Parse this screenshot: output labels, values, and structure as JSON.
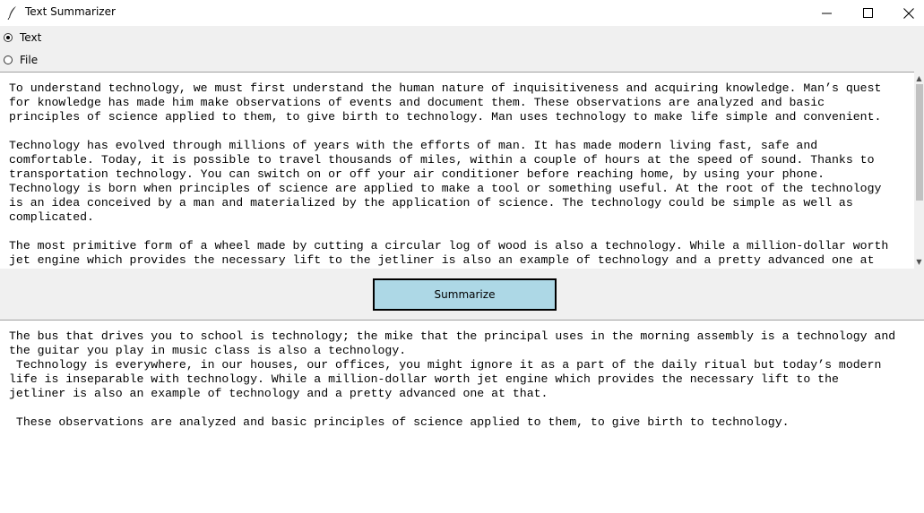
{
  "window": {
    "title": "Text Summarizer"
  },
  "input_mode": {
    "options": [
      {
        "label": "Text",
        "selected": true
      },
      {
        "label": "File",
        "selected": false
      }
    ]
  },
  "input_text": "To understand technology, we must first understand the human nature of inquisitiveness and acquiring knowledge. Man’s quest\nfor knowledge has made him make observations of events and document them. These observations are analyzed and basic\nprinciples of science applied to them, to give birth to technology. Man uses technology to make life simple and convenient.\n\nTechnology has evolved through millions of years with the efforts of man. It has made modern living fast, safe and\ncomfortable. Today, it is possible to travel thousands of miles, within a couple of hours at the speed of sound. Thanks to\ntransportation technology. You can switch on or off your air conditioner before reaching home, by using your phone.\nTechnology is born when principles of science are applied to make a tool or something useful. At the root of the technology\nis an idea conceived by a man and materialized by the application of science. The technology could be simple as well as\ncomplicated.\n\nThe most primitive form of a wheel made by cutting a circular log of wood is also a technology. While a million-dollar worth\njet engine which provides the necessary lift to the jetliner is also an example of technology and a pretty advanced one at",
  "summarize_button": {
    "label": "Summarize"
  },
  "output_text": "The bus that drives you to school is technology; the mike that the principal uses in the morning assembly is a technology and\nthe guitar you play in music class is also a technology.\n Technology is everywhere, in our houses, our offices, you might ignore it as a part of the daily ritual but today’s modern\nlife is inseparable with technology. While a million-dollar worth jet engine which provides the necessary lift to the\njetliner is also an example of technology and a pretty advanced one at that.\n\n These observations are analyzed and basic principles of science applied to them, to give birth to technology."
}
